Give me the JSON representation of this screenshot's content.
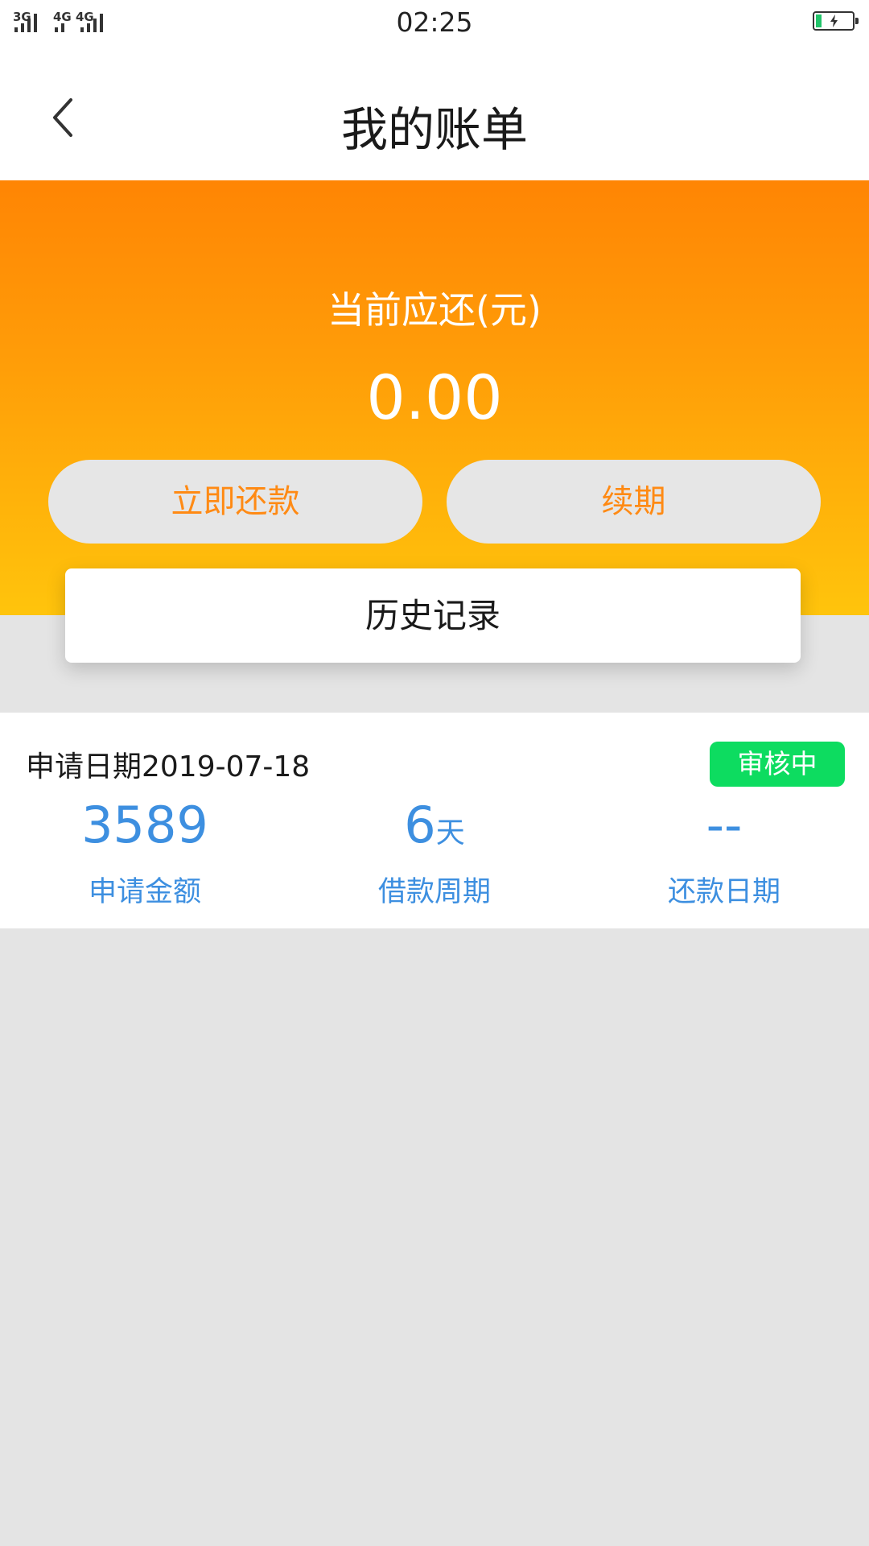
{
  "status_bar": {
    "network_1": "3G",
    "network_2": "4G",
    "network_3": "4G",
    "time": "02:25",
    "battery_icon": "battery-charging-icon"
  },
  "header": {
    "back_icon": "chevron-left-icon",
    "title": "我的账单"
  },
  "summary": {
    "label": "当前应还(元)",
    "amount": "0.00",
    "repay_label": "立即还款",
    "renew_label": "续期",
    "history_label": "历史记录"
  },
  "record": {
    "apply_date": "申请日期2019-07-18",
    "status": "审核中",
    "amount_value": "3589",
    "amount_label": "申请金额",
    "period_value": "6",
    "period_unit": "天",
    "period_label": "借款周期",
    "repay_date_value": "--",
    "repay_date_label": "还款日期"
  },
  "colors": {
    "accent_orange": "#ff8a14",
    "hero_gradient_top": "#ff8504",
    "hero_gradient_bottom": "#ffc40c",
    "status_green": "#0ddc60",
    "stat_blue": "#3d8fe0",
    "background": "#e4e4e4"
  }
}
